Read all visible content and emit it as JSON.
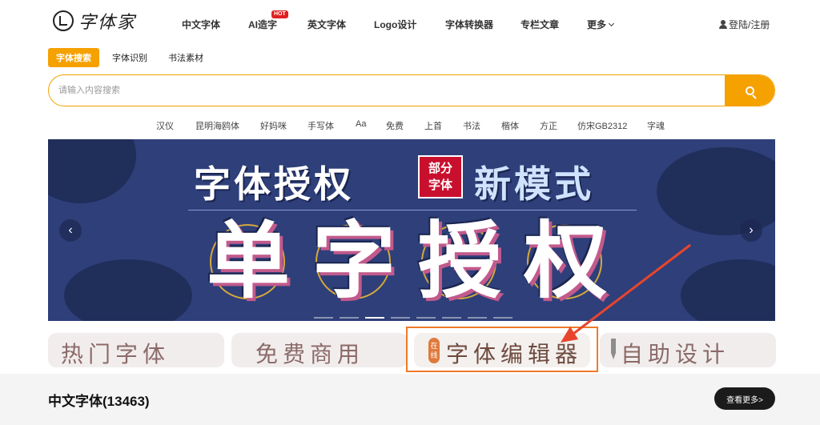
{
  "header": {
    "logo_text": "字体家",
    "nav": [
      "中文字体",
      "AI造字",
      "英文字体",
      "Logo设计",
      "字体转换器",
      "专栏文章",
      "更多"
    ],
    "hot_badge": "HOT",
    "login": "登陆/注册"
  },
  "search": {
    "tabs": [
      "字体搜索",
      "字体识别",
      "书法素材"
    ],
    "placeholder": "请输入内容搜索",
    "keywords": [
      "汉仪",
      "昆明海鸥体",
      "好妈咪",
      "手写体",
      "Aa",
      "免费",
      "上首",
      "书法",
      "楷体",
      "方正",
      "仿宋GB2312",
      "字魂"
    ]
  },
  "banner": {
    "title_left": "字体授权",
    "seal_line1": "部分",
    "seal_line2": "字体",
    "title_right": "新模式",
    "main": [
      "单",
      "字",
      "授",
      "权"
    ],
    "prev": "‹",
    "next": "›",
    "active_slide": 3,
    "slide_count": 8
  },
  "cards": [
    "热门字体",
    "免费商用",
    "字体编辑器",
    "自助设计"
  ],
  "card_badge": "在线",
  "section": {
    "title": "中文字体(13463)",
    "more": "查看更多>"
  },
  "colors": {
    "accent": "#f5a100",
    "banner": "#2e3f7a",
    "callout": "#e8452c"
  }
}
